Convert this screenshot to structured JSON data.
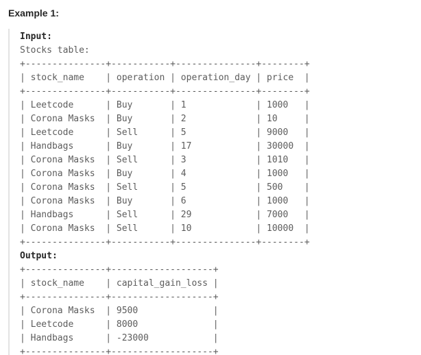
{
  "heading": "Example 1:",
  "input_label": "Input:",
  "input_lines": [
    "Stocks table:",
    "+---------------+-----------+---------------+--------+",
    "| stock_name    | operation | operation_day | price  |",
    "+---------------+-----------+---------------+--------+",
    "| Leetcode      | Buy       | 1             | 1000   |",
    "| Corona Masks  | Buy       | 2             | 10     |",
    "| Leetcode      | Sell      | 5             | 9000   |",
    "| Handbags      | Buy       | 17            | 30000  |",
    "| Corona Masks  | Sell      | 3             | 1010   |",
    "| Corona Masks  | Buy       | 4             | 1000   |",
    "| Corona Masks  | Sell      | 5             | 500    |",
    "| Corona Masks  | Buy       | 6             | 1000   |",
    "| Handbags      | Sell      | 29            | 7000   |",
    "| Corona Masks  | Sell      | 10            | 10000  |",
    "+---------------+-----------+---------------+--------+"
  ],
  "output_label": "Output:",
  "output_lines": [
    "+---------------+-------------------+",
    "| stock_name    | capital_gain_loss |",
    "+---------------+-------------------+",
    "| Corona Masks  | 9500              |",
    "| Leetcode      | 8000              |",
    "| Handbags      | -23000            |",
    "+---------------+-------------------+"
  ]
}
